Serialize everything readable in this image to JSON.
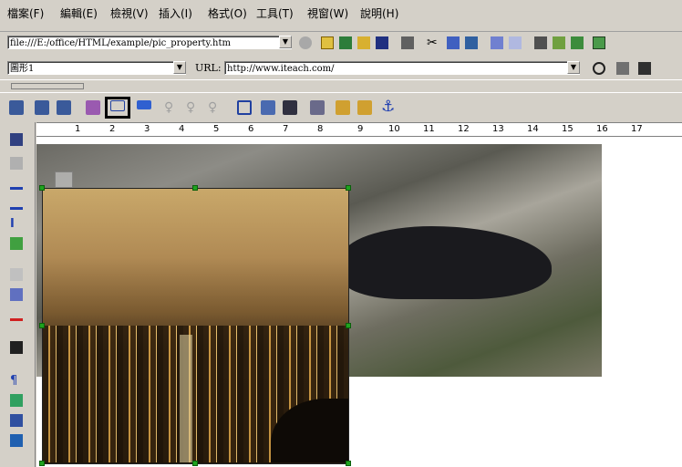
{
  "menu": [
    "檔案(F)",
    "編輯(E)",
    "檢視(V)",
    "插入(I)",
    "格式(O)",
    "工具(T)",
    "視窗(W)",
    "說明(H)"
  ],
  "address": {
    "path": "file:///E:/office/HTML/example/pic_property.htm"
  },
  "object_bar": {
    "name": "圖形1",
    "url_label": "URL:",
    "url_value": "http://www.iteach.com/"
  },
  "ruler": {
    "numbers": [
      "1",
      "2",
      "3",
      "4",
      "5",
      "6",
      "7",
      "8",
      "9",
      "10",
      "11",
      "12",
      "13",
      "14",
      "15",
      "16",
      "17"
    ]
  },
  "colors": {
    "chrome": "#d4d0c8",
    "selection_handle": "#1fa31f",
    "highlight_border": "#000000"
  },
  "toolbar3_icons": [
    "align-left-icon",
    "align-center-icon",
    "align-right-icon",
    "paint-icon",
    "text-wrap-right-icon",
    "text-wrap-left-icon",
    "gray-icon-1",
    "gray-icon-2",
    "gray-icon-3",
    "frame-icon",
    "table-icon",
    "grid-icon",
    "bring-front-icon",
    "send-back-icon",
    "layer-icon",
    "anchor-icon"
  ],
  "highlighted_button": "text-wrap-right-icon"
}
